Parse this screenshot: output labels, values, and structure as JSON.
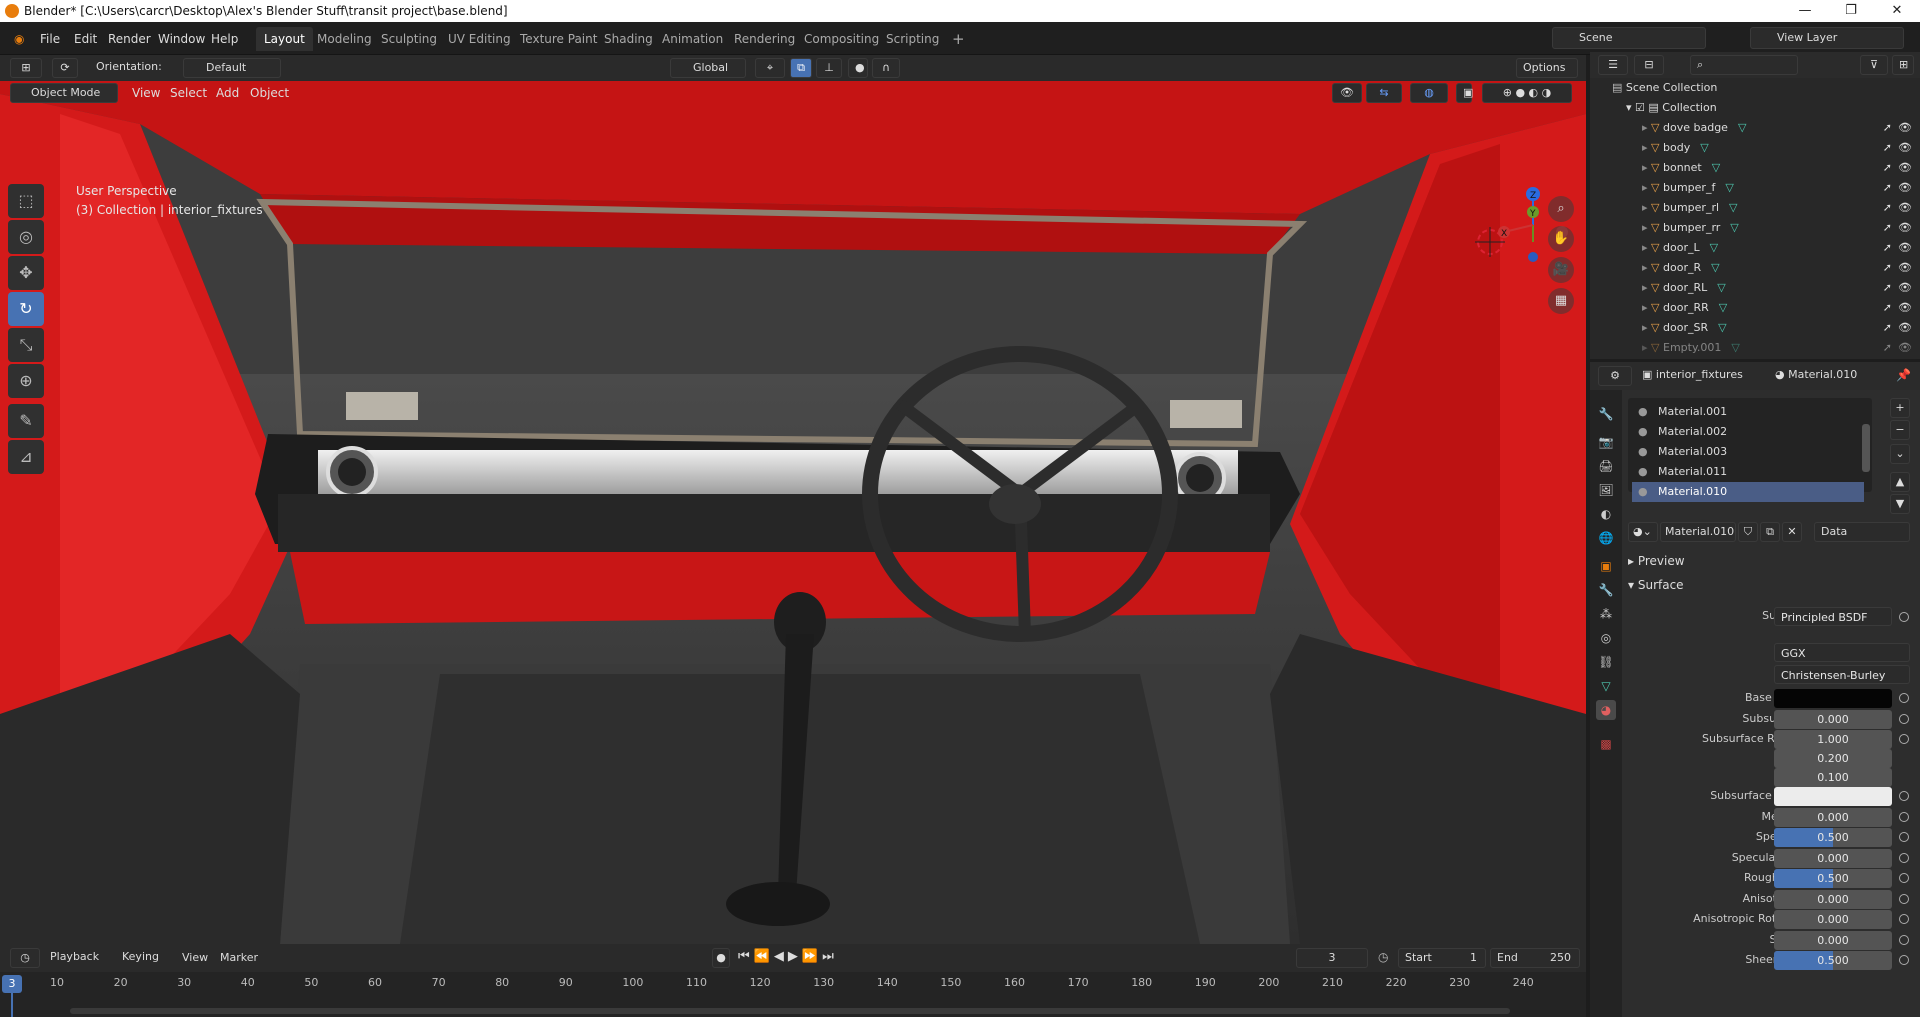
{
  "window": {
    "title": "Blender* [C:\\Users\\carcr\\Desktop\\Alex's Blender Stuff\\transit project\\base.blend]",
    "minimize": "—",
    "maximize": "❐",
    "close": "✕"
  },
  "menu": {
    "items": [
      "File",
      "Edit",
      "Render",
      "Window",
      "Help"
    ],
    "workspace_tabs": [
      "Layout",
      "Modeling",
      "Sculpting",
      "UV Editing",
      "Texture Paint",
      "Shading",
      "Animation",
      "Rendering",
      "Compositing",
      "Scripting"
    ],
    "add_tab": "+",
    "scene_label": "Scene",
    "view_layer_label": "View Layer"
  },
  "viewport_header": {
    "orientation_label": "Orientation:",
    "orientation_value": "Default",
    "transform_space": "Global",
    "options": "Options",
    "mode": "Object Mode",
    "menus": [
      "View",
      "Select",
      "Add",
      "Object"
    ]
  },
  "viewport": {
    "perspective_label": "User Perspective",
    "collection_info": "(3) Collection | interior_fixtures",
    "gizmo": {
      "z": "Z",
      "y": "Y",
      "x": "X"
    }
  },
  "tools": [
    {
      "icon": "select-box-icon",
      "glyph": "⬚",
      "active": false
    },
    {
      "icon": "cursor-icon",
      "glyph": "◎",
      "active": false
    },
    {
      "icon": "move-icon",
      "glyph": "✥",
      "active": false
    },
    {
      "icon": "rotate-icon",
      "glyph": "↻",
      "active": true
    },
    {
      "icon": "scale-icon",
      "glyph": "⤡",
      "active": false
    },
    {
      "icon": "transform-icon",
      "glyph": "⊕",
      "active": false
    },
    {
      "icon": "annotate-icon",
      "glyph": "✎",
      "active": false
    },
    {
      "icon": "measure-icon",
      "glyph": "📐",
      "active": false
    }
  ],
  "outliner": {
    "root": "Scene Collection",
    "collection": "Collection",
    "objects": [
      "dove badge",
      "body",
      "bonnet",
      "bumper_f",
      "bumper_rl",
      "bumper_rr",
      "door_L",
      "door_R",
      "door_RL",
      "door_RR",
      "door_SR",
      "Empty.001"
    ]
  },
  "properties": {
    "object_name": "interior_fixtures",
    "material_name": "Material.010",
    "material_slots": [
      "Material.001",
      "Material.002",
      "Material.003",
      "Material.011",
      "Material.010"
    ],
    "selected_slot": "Material.010",
    "active_material": "Material.010",
    "link_mode": "Data",
    "panels": {
      "preview": "Preview",
      "surface": "Surface"
    },
    "surface_shader_label": "Surface",
    "surface_shader": "Principled BSDF",
    "distribution": "GGX",
    "subsurface_method": "Christensen-Burley",
    "base_color_hex": "#050505",
    "subsurface_color_hex": "#ececec",
    "fields": [
      {
        "label": "Base Color",
        "kind": "color",
        "color": "#050505"
      },
      {
        "label": "Subsurface",
        "value": "0.000",
        "fill": 0
      },
      {
        "label": "Subsurface Radius",
        "value": "1.000",
        "fill": 0
      },
      {
        "label": "",
        "value": "0.200",
        "fill": 0
      },
      {
        "label": "",
        "value": "0.100",
        "fill": 0
      },
      {
        "label": "Subsurface Color",
        "kind": "color",
        "color": "#ececec"
      },
      {
        "label": "Metallic",
        "value": "0.000",
        "fill": 0
      },
      {
        "label": "Specular",
        "value": "0.500",
        "fill": 0.5
      },
      {
        "label": "Specular Tint",
        "value": "0.000",
        "fill": 0
      },
      {
        "label": "Roughness",
        "value": "0.500",
        "fill": 0.5
      },
      {
        "label": "Anisotropic",
        "value": "0.000",
        "fill": 0
      },
      {
        "label": "Anisotropic Rotation",
        "value": "0.000",
        "fill": 0
      },
      {
        "label": "Sheen",
        "value": "0.000",
        "fill": 0
      },
      {
        "label": "Sheen Tint",
        "value": "0.500",
        "fill": 0.5
      }
    ]
  },
  "timeline": {
    "menus": [
      "Playback",
      "Keying",
      "View",
      "Marker"
    ],
    "current_frame": "3",
    "start_label": "Start",
    "start": "1",
    "end_label": "End",
    "end": "250",
    "ruler_current": "3",
    "ruler": [
      "10",
      "20",
      "30",
      "40",
      "50",
      "60",
      "70",
      "80",
      "90",
      "100",
      "110",
      "120",
      "130",
      "140",
      "150",
      "160",
      "170",
      "180",
      "190",
      "200",
      "210",
      "220",
      "230",
      "240"
    ]
  },
  "colors": {
    "accent": "#4772b3",
    "body_red": "#d01818",
    "blender_orange": "#e87d0d"
  }
}
